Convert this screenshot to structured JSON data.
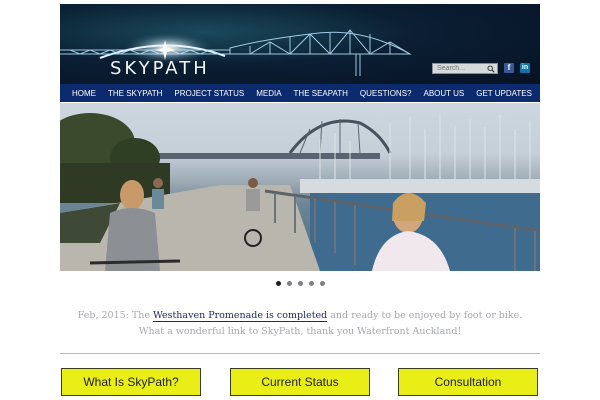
{
  "header": {
    "logo_text": "SKYPATH",
    "search_placeholder": "Search...",
    "social": {
      "facebook": "f",
      "linkedin": "in"
    }
  },
  "nav": {
    "items": [
      "HOME",
      "THE SKYPATH",
      "PROJECT STATUS",
      "MEDIA",
      "THE SEAPATH",
      "QUESTIONS?",
      "ABOUT US",
      "GET UPDATES"
    ]
  },
  "carousel": {
    "slide_count": 5,
    "active_index": 0
  },
  "news": {
    "prefix": "Feb, 2015: The ",
    "link": "Westhaven Promenade is completed",
    "suffix": " and ready to be enjoyed by foot or bike.",
    "line2": "What a wonderful link to SkyPath, thank you Waterfront Auckland!"
  },
  "cta": {
    "what_is": "What Is SkyPath?",
    "status": "Current Status",
    "consultation": "Consultation"
  },
  "colors": {
    "nav_bg": "#0c2a6e",
    "cta_bg": "#e8ee16",
    "link": "#1c2a6b"
  }
}
